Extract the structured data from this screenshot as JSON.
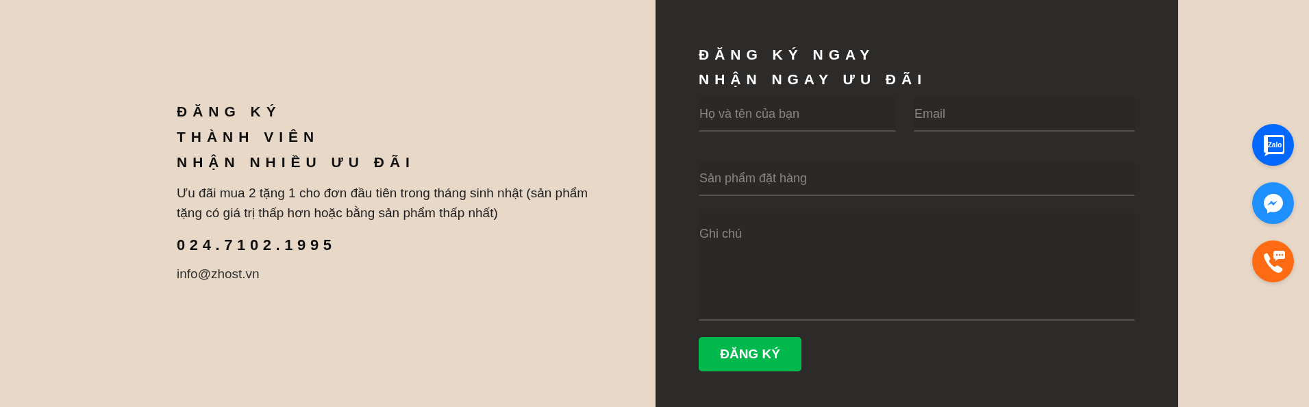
{
  "promo": {
    "heading_lines": [
      "ĐĂNG KÝ",
      "THÀNH VIÊN",
      "NHẬN NHIỀU ƯU ĐÃI"
    ],
    "description": "Ưu đãi mua 2 tặng 1 cho đơn đầu tiên trong tháng sinh nhật (sản phẩm tặng có giá trị thấp hơn hoặc bằng sản phẩm thấp nhất)",
    "phone": "024.7102.1995",
    "email": "info@zhost.vn"
  },
  "form": {
    "heading_lines": [
      "ĐĂNG KÝ NGAY",
      "NHẬN NGAY ƯU ĐÃI"
    ],
    "fields": [
      {
        "kind": "input",
        "placeholder": "Họ và tên của bạn"
      },
      {
        "kind": "input",
        "placeholder": "Email"
      },
      {
        "kind": "input",
        "placeholder": "Sản phẩm đặt hàng"
      },
      {
        "kind": "textarea",
        "placeholder": "Ghi chú"
      }
    ],
    "submit": "ĐĂNG KÝ"
  },
  "floating_buttons": [
    {
      "kind": "zalo",
      "label": "Zalo",
      "color": "#0068ff"
    },
    {
      "kind": "messenger",
      "color": "#1e90ff"
    },
    {
      "kind": "phone",
      "color": "#ff6b12"
    }
  ]
}
